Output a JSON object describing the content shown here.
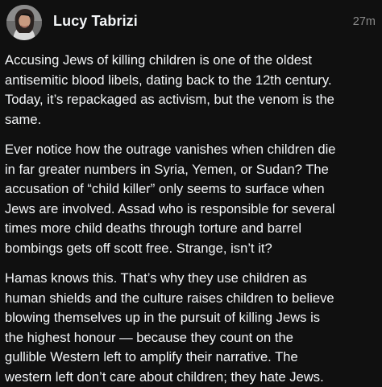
{
  "post": {
    "author": "Lucy Tabrizi",
    "timestamp": "27m",
    "avatar_icon": "profile-photo-icon",
    "paragraphs": [
      "Accusing Jews of killing children is one of the oldest\nantisemitic blood libels, dating back to the 12th century.\nToday, it’s repackaged as activism, but the venom is the\nsame.",
      "Ever notice how the outrage vanishes when children die\nin far greater numbers in Syria, Yemen, or Sudan? The\naccusation of “child killer” only seems to surface when\nJews are involved. Assad who is responsible for several\ntimes more child deaths through torture and barrel\nbombings gets off scott free. Strange, isn’t it?",
      "Hamas knows this. That’s why they use children as\nhuman shields and the culture raises children to believe\nblowing themselves up in the pursuit of killing Jews is\nthe highest honour — because they count on the\ngullible Western left to amplify their narrative. The\nwestern left don’t care about children; they hate Jews."
    ]
  },
  "colors": {
    "background": "#101010",
    "text": "#f3f5f7",
    "muted": "#8a8a8a"
  }
}
